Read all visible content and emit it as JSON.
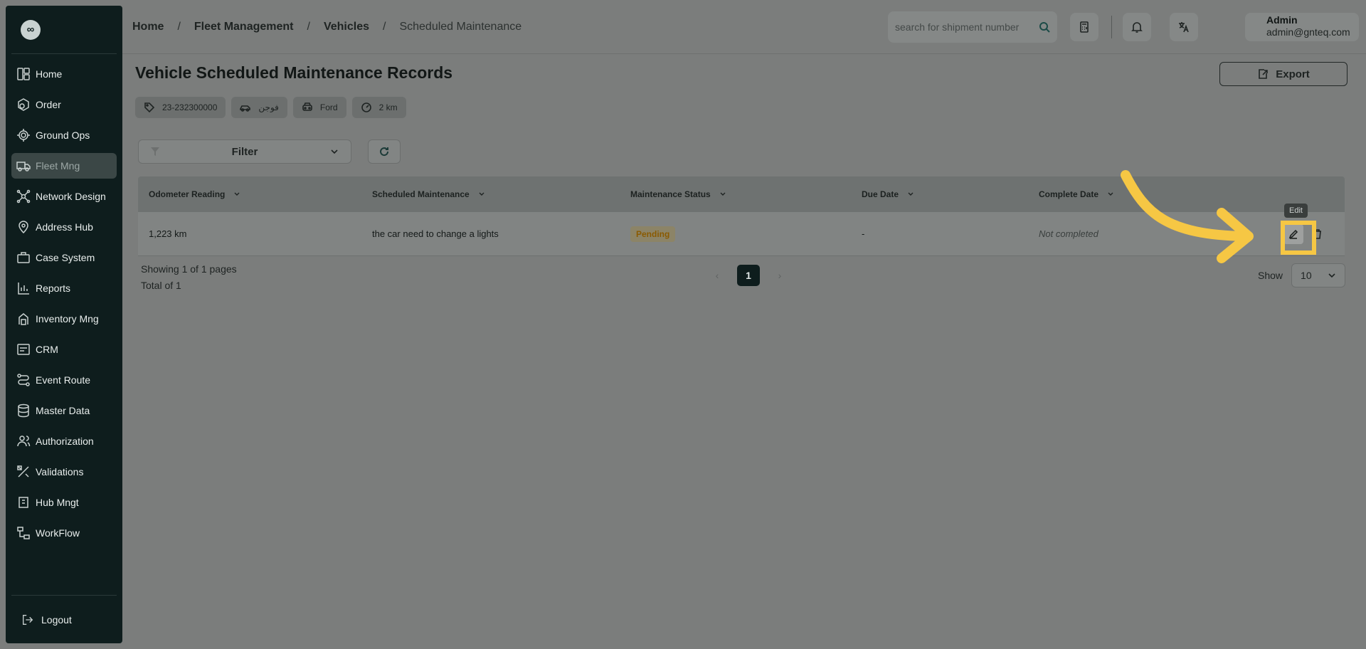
{
  "sidebar": {
    "logo_text": "∞",
    "items": [
      {
        "label": "Home",
        "icon": "home-grid-icon"
      },
      {
        "label": "Order",
        "icon": "order-icon"
      },
      {
        "label": "Ground Ops",
        "icon": "ground-ops-icon"
      },
      {
        "label": "Fleet Mng",
        "icon": "truck-icon"
      },
      {
        "label": "Network Design",
        "icon": "network-icon"
      },
      {
        "label": "Address Hub",
        "icon": "location-icon"
      },
      {
        "label": "Case System",
        "icon": "case-icon"
      },
      {
        "label": "Reports",
        "icon": "reports-icon"
      },
      {
        "label": "Inventory Mng",
        "icon": "inventory-icon"
      },
      {
        "label": "CRM",
        "icon": "crm-icon"
      },
      {
        "label": "Event Route",
        "icon": "route-icon"
      },
      {
        "label": "Master Data",
        "icon": "database-icon"
      },
      {
        "label": "Authorization",
        "icon": "users-icon"
      },
      {
        "label": "Validations",
        "icon": "validations-icon"
      },
      {
        "label": "Hub Mngt",
        "icon": "hub-icon"
      },
      {
        "label": "WorkFlow",
        "icon": "workflow-icon"
      }
    ],
    "active_index": 3,
    "logout_label": "Logout"
  },
  "header": {
    "breadcrumb": [
      "Home",
      "Fleet Management",
      "Vehicles",
      "Scheduled Maintenance"
    ],
    "search_placeholder": "search for shipment number",
    "user_name": "Admin",
    "user_email": "admin@gnteq.com"
  },
  "page": {
    "title": "Vehicle Scheduled Maintenance Records",
    "export_label": "Export",
    "tags": [
      {
        "icon": "tag-icon",
        "text": "23-232300000"
      },
      {
        "icon": "car-icon",
        "text": "فوجن"
      },
      {
        "icon": "car-front-icon",
        "text": "Ford"
      },
      {
        "icon": "gauge-icon",
        "text": "2 km"
      }
    ],
    "filter_label": "Filter"
  },
  "table": {
    "columns": [
      "Odometer Reading",
      "Scheduled Maintenance",
      "Maintenance Status",
      "Due Date",
      "Complete Date"
    ],
    "rows": [
      {
        "odometer": "1,223 km",
        "maintenance": "the car need to change a lights",
        "status": "Pending",
        "due": "-",
        "complete": "Not completed"
      }
    ]
  },
  "pagination": {
    "showing": "Showing 1 of 1 pages",
    "total": "Total of 1",
    "current_page": "1",
    "show_label": "Show",
    "page_size": "10"
  },
  "tooltip": {
    "edit": "Edit"
  },
  "colors": {
    "accent": "#0e1d1d",
    "highlight": "#f6c744",
    "pending": "#8a5a00"
  }
}
